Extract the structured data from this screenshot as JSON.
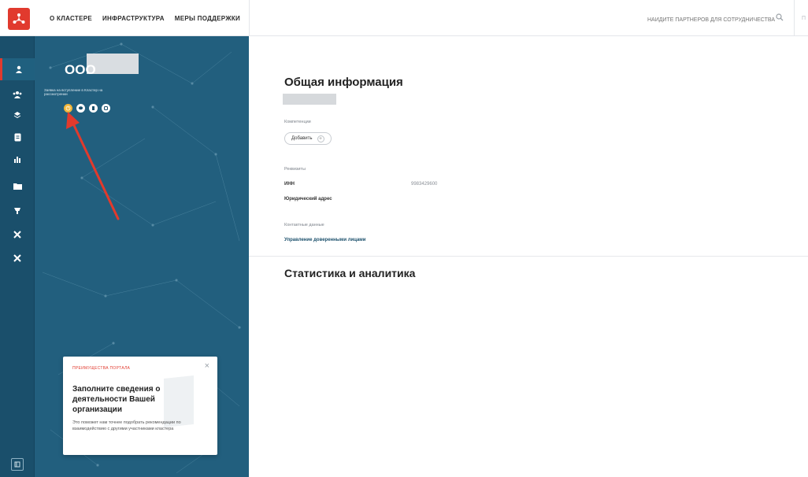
{
  "header": {
    "nav": [
      "О КЛАСТЕРЕ",
      "ИНФРАСТРУКТУРА",
      "МЕРЫ ПОДДЕРЖКИ"
    ],
    "search_placeholder": "НАЙДИТЕ ПАРТНЕРОВ ДЛЯ СОТРУДНИЧЕСТВА",
    "right_text": "П"
  },
  "rail": {
    "icons": [
      "user-icon",
      "team-icon",
      "layers-icon",
      "document-icon",
      "chart-icon",
      "folder-icon",
      "cart-icon",
      "tools-icon",
      "tools-icon-2"
    ],
    "bottom_icon": "collapse-icon"
  },
  "panel": {
    "org_name": "ООО",
    "status_text": "Заявка на вступление в Кластер на рассмотрении",
    "card": {
      "tag": "ПРЕИМУЩЕСТВА ПОРТАЛА",
      "close": "×",
      "title": "Заполните сведения о деятельности Вашей организации",
      "text": "Это поможет нам точнее подобрать рекомендации по взаимодействию с другими участниками кластера"
    }
  },
  "main": {
    "general_title": "Общая информация",
    "competences_label": "Компетенции",
    "add_button": "Добавить",
    "add_plus": "+",
    "requisites_label": "Реквизиты",
    "inn_key": "ИНН",
    "inn_value": "9983429600",
    "address_key": "Юридический адрес",
    "contacts_label": "Контактные данные",
    "manage_link": "Управление доверенными лицами",
    "stats_title": "Статистика и аналитика"
  },
  "colors": {
    "brand_red": "#e13a2e",
    "rail_blue": "#1a4f6b",
    "panel_blue": "#225f7e",
    "status_yellow": "#f2b739"
  }
}
